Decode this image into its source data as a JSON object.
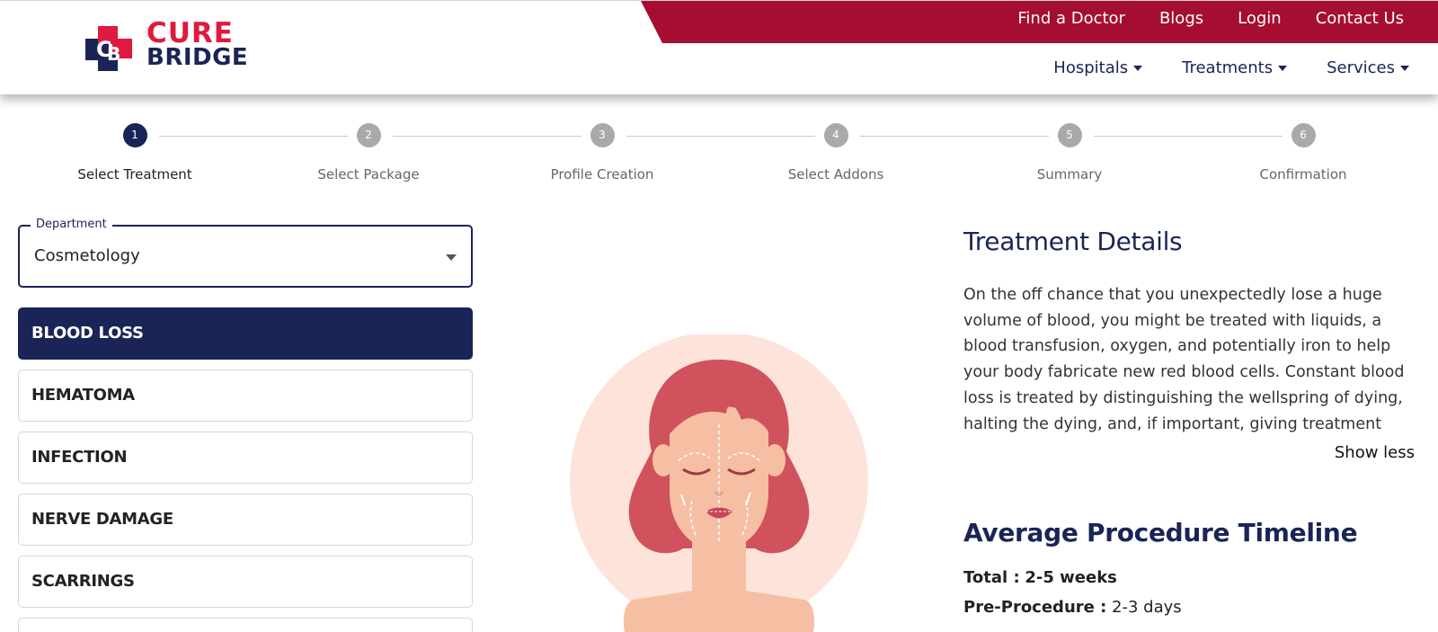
{
  "brand": {
    "line1": "CURE",
    "line2": "BRIDGE",
    "colors": {
      "red": "#e0193f",
      "navy": "#1b2456",
      "bar": "#a50e31"
    }
  },
  "topnav": {
    "find_doctor": "Find a Doctor",
    "blogs": "Blogs",
    "login": "Login",
    "contact": "Contact Us"
  },
  "subnav": {
    "hospitals": "Hospitals",
    "treatments": "Treatments",
    "services": "Services"
  },
  "steps": [
    {
      "num": "1",
      "label": "Select Treatment"
    },
    {
      "num": "2",
      "label": "Select Package"
    },
    {
      "num": "3",
      "label": "Profile Creation"
    },
    {
      "num": "4",
      "label": "Select Addons"
    },
    {
      "num": "5",
      "label": "Summary"
    },
    {
      "num": "6",
      "label": "Confirmation"
    }
  ],
  "department": {
    "legend": "Department",
    "value": "Cosmetology"
  },
  "treatments": [
    "BLOOD LOSS",
    "HEMATOMA",
    "INFECTION",
    "NERVE DAMAGE",
    "SCARRINGS"
  ],
  "details": {
    "title": "Treatment Details",
    "description": "On the off chance that you unexpectedly lose a huge volume of blood, you might be treated with liquids, a blood transfusion, oxygen, and potentially iron to help your body fabricate new red blood cells. Constant blood loss is treated by distinguishing the wellspring of dying, halting the dying, and, if important, giving treatment to…",
    "toggle": "Show less"
  },
  "timeline": {
    "title": "Average Procedure Timeline",
    "total_label": "Total :",
    "total_value": "2-5 weeks",
    "pre_label": "Pre-Procedure :",
    "pre_value": "2-3 days"
  }
}
